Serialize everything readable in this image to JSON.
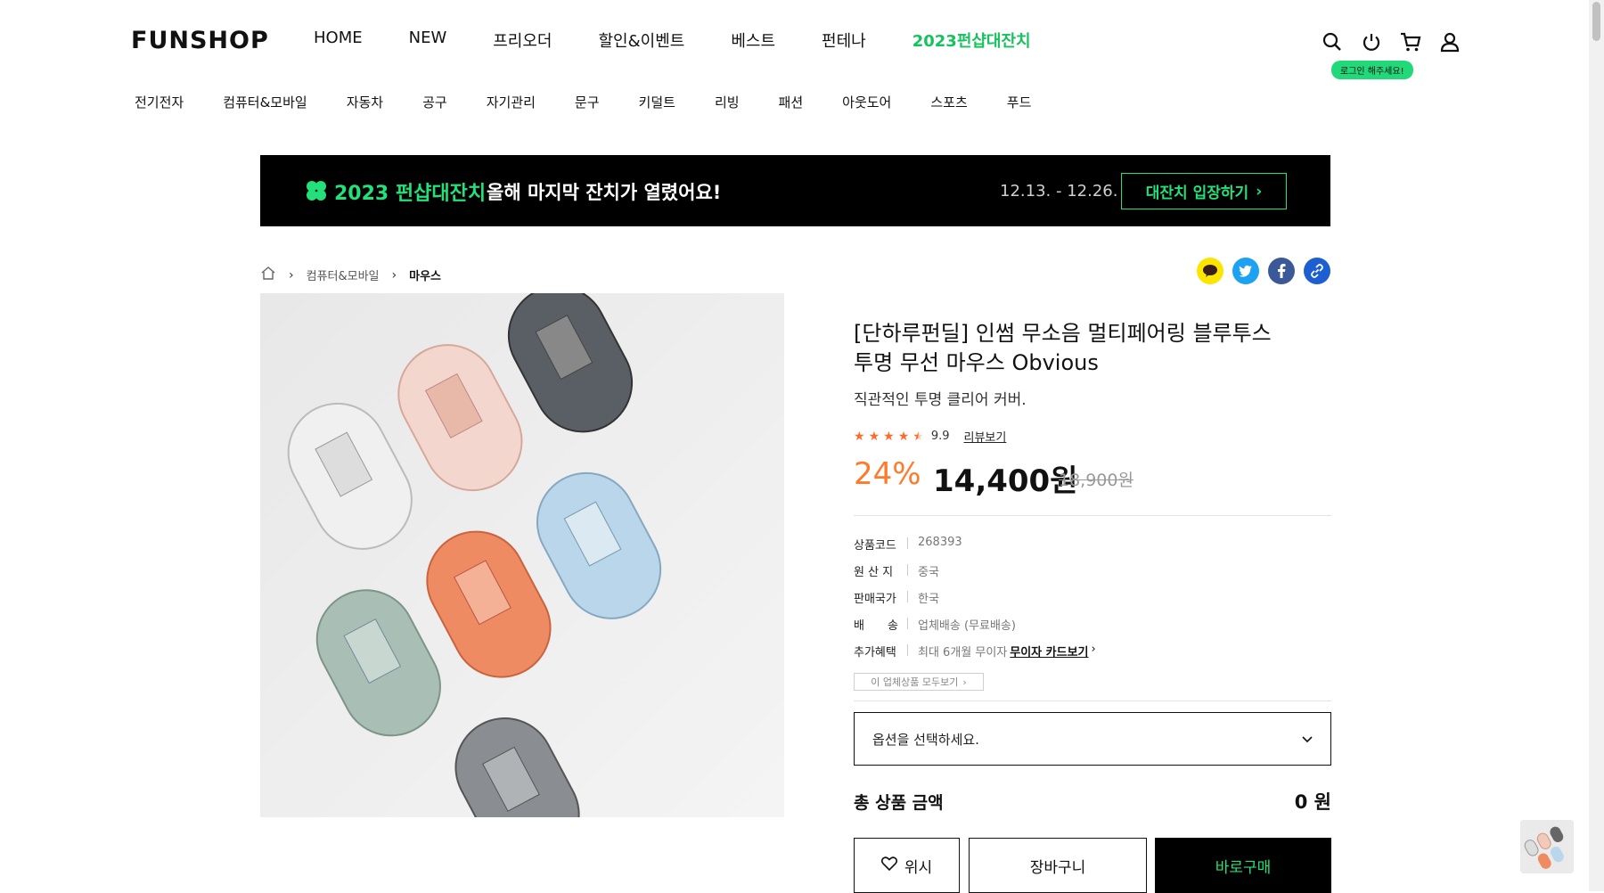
{
  "header": {
    "logo": "FUNSHOP",
    "nav": [
      "HOME",
      "NEW",
      "프리오더",
      "할인&이벤트",
      "베스트",
      "펀테나",
      "2023펀샵대잔치"
    ],
    "login_badge": "로그인 해주세요!",
    "categories": [
      "전기전자",
      "컴퓨터&모바일",
      "자동차",
      "공구",
      "자기관리",
      "문구",
      "키덜트",
      "리빙",
      "패션",
      "아웃도어",
      "스포츠",
      "푸드"
    ]
  },
  "banner": {
    "title": "2023 펀샵대잔치",
    "message": "올해 마지막 잔치가 열렸어요!",
    "date": "12.13. - 12.26.",
    "button": "대잔치 입장하기"
  },
  "breadcrumb": {
    "category": "컴퓨터&모바일",
    "current": "마우스"
  },
  "product": {
    "title_line1": "[단하루펀딜] 인썸 무소음 멀티페어링 블루투스",
    "title_line2": "투명 무선 마우스 Obvious",
    "subtitle": "직관적인 투명 클리어 커버.",
    "rating": "9.9",
    "stars": 4.5,
    "review_link": "리뷰보기",
    "discount": "24%",
    "price": "14,400원",
    "original_price": "18,900원",
    "specs": [
      {
        "key": "상품코드",
        "value": "268393"
      },
      {
        "key": "원 산 지",
        "value": "중국"
      },
      {
        "key": "판매국가",
        "value": "한국"
      },
      {
        "key": "배　　송",
        "value": "업체배송 (무료배송)"
      },
      {
        "key": "추가혜택",
        "value": "최대 6개월 무이자",
        "link": "무이자 카드보기"
      }
    ],
    "vendor_all": "이 업체상품 모두보기",
    "option_placeholder": "옵션을 선택하세요.",
    "total_label": "총 상품 금액",
    "total_value": "0 원",
    "wish_label": "위시",
    "cart_label": "장바구니",
    "buy_label": "바로구매"
  },
  "colors": {
    "accent_green": "#22e07a",
    "discount_orange": "#ff7a2a",
    "kakao": "#fee500",
    "twitter": "#1da1f2",
    "facebook": "#3b5998",
    "link_share": "#1d5fd0"
  }
}
